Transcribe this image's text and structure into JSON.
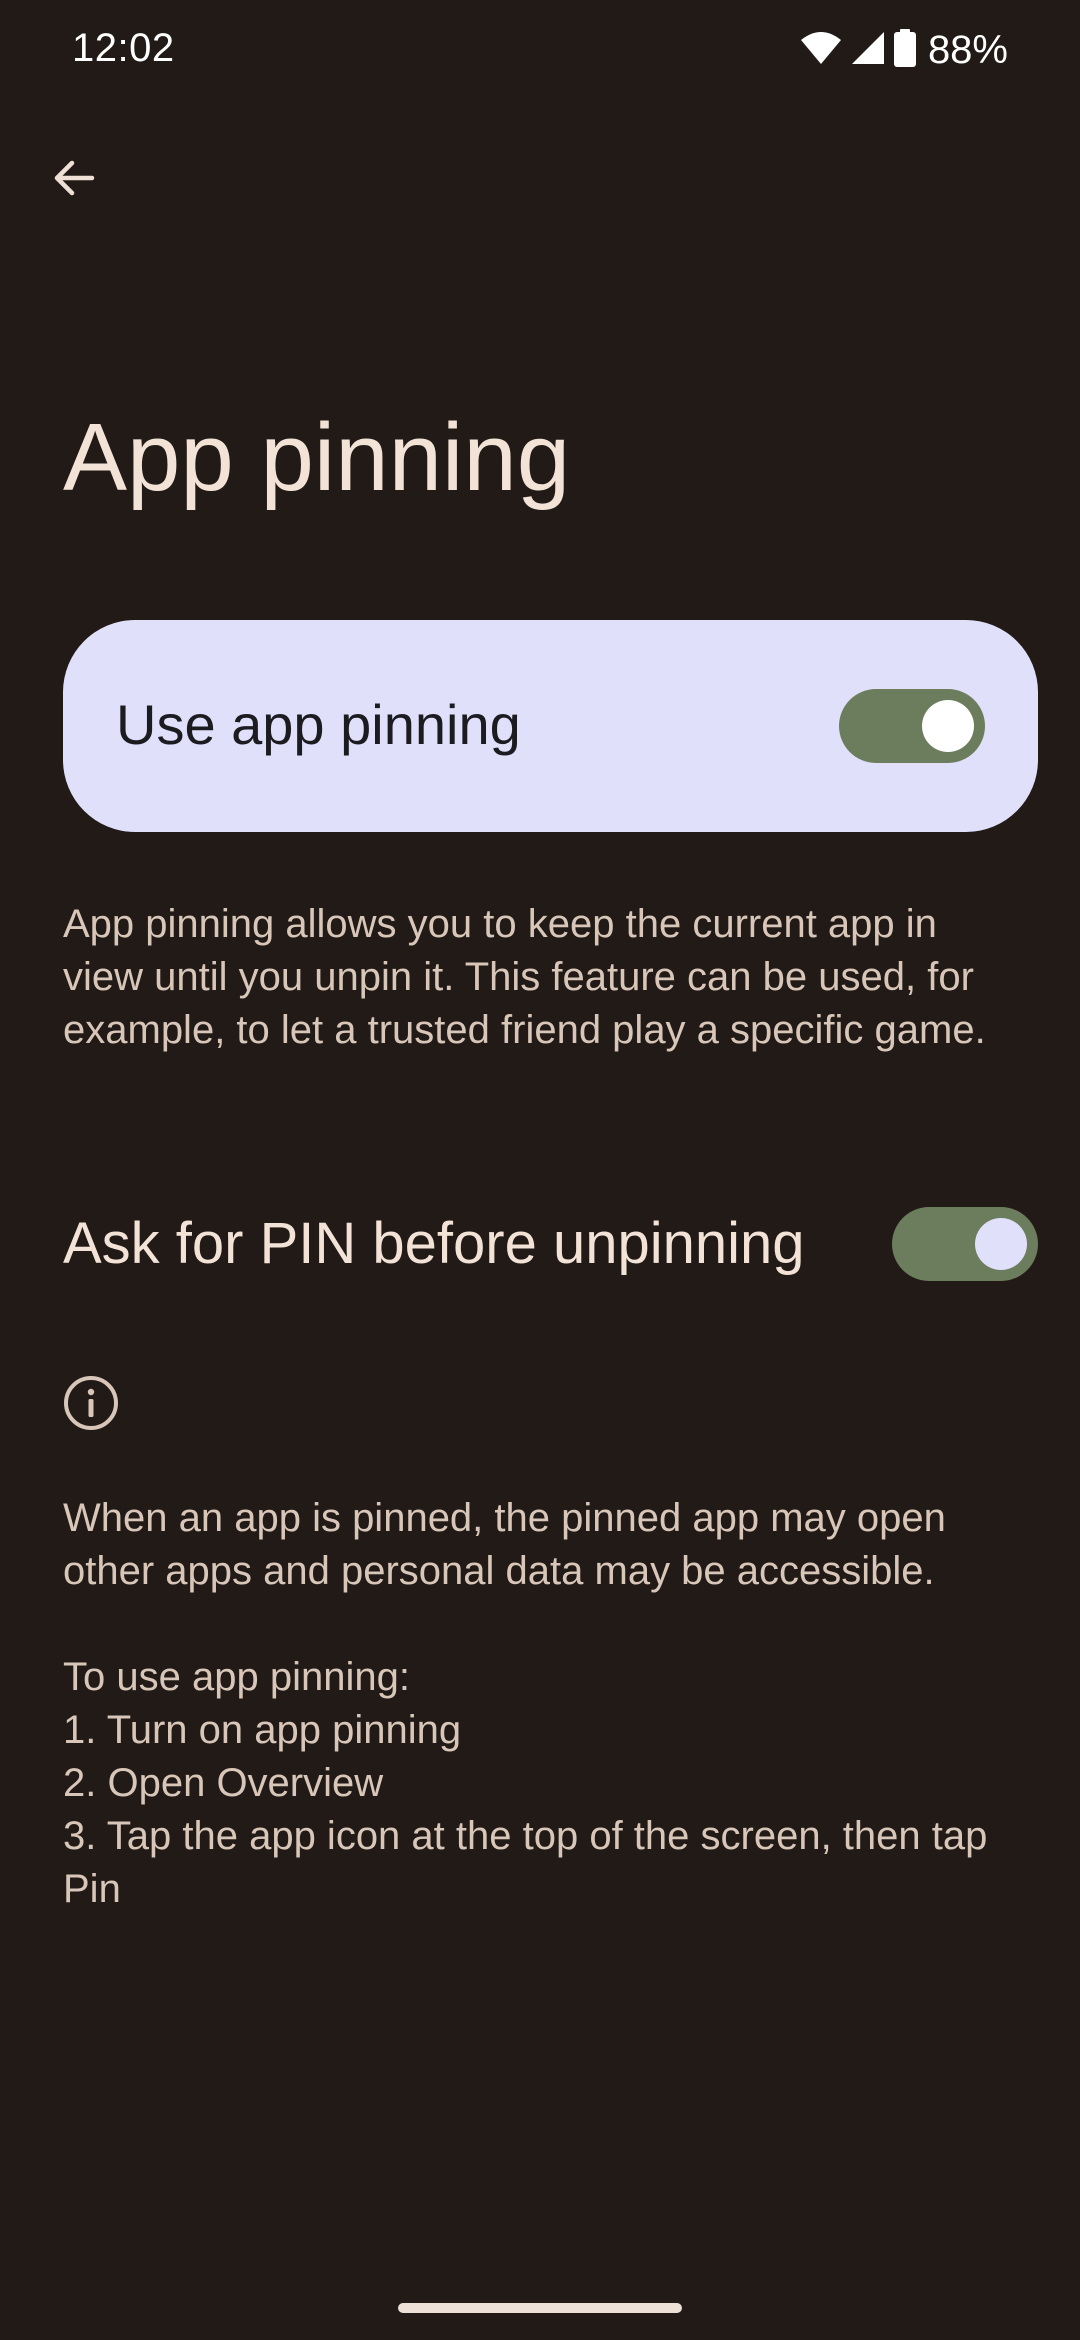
{
  "status_bar": {
    "time": "12:02",
    "battery_percent": "88%",
    "icons": [
      "wifi-icon",
      "cell-signal-icon",
      "battery-icon"
    ]
  },
  "toolbar": {
    "back_icon": "arrow-back-icon"
  },
  "page": {
    "title": "App pinning"
  },
  "main_switch": {
    "label": "Use app pinning",
    "checked": true
  },
  "description": "App pinning allows you to keep the current app in view until you unpin it. This feature can be used, for example, to let a trusted friend play a specific game.",
  "pin_setting": {
    "label": "Ask for PIN before unpinning",
    "checked": true
  },
  "footer": {
    "icon": "info-icon",
    "warning": "When an app is pinned, the pinned app may open other apps and personal data may be accessible.",
    "instructions_heading": "To use app pinning:",
    "steps": [
      "1. Turn on app pinning",
      "2. Open Overview",
      "3. Tap the app icon at the top of the screen, then tap Pin"
    ]
  },
  "colors": {
    "background": "#211a16",
    "card": "#e0e0fb",
    "toggle_track": "#6b7d5c",
    "text_primary": "#f3e3d7",
    "text_secondary": "#d8c6b9"
  }
}
